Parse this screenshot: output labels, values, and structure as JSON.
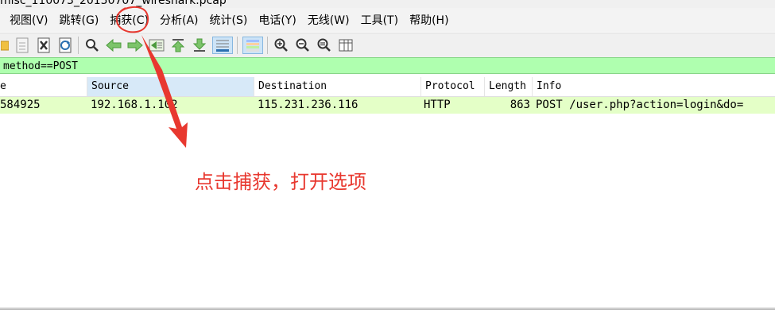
{
  "window": {
    "title": "misc_110073_20150707_wireshark.pcap"
  },
  "menu": [
    {
      "label": "视图(V)"
    },
    {
      "label": "跳转(G)"
    },
    {
      "label": "捕获(C)"
    },
    {
      "label": "分析(A)"
    },
    {
      "label": "统计(S)"
    },
    {
      "label": "电话(Y)"
    },
    {
      "label": "无线(W)"
    },
    {
      "label": "工具(T)"
    },
    {
      "label": "帮助(H)"
    }
  ],
  "toolbar": {
    "icons": [
      "folder-icon",
      "document-icon",
      "close-file-icon",
      "reload-icon",
      "find-icon",
      "back-icon",
      "forward-icon",
      "goto-icon",
      "first-packet-icon",
      "last-packet-icon",
      "autoscroll-icon",
      "colorize-icon",
      "zoom-in-icon",
      "zoom-out-icon",
      "zoom-reset-icon",
      "resize-columns-icon"
    ]
  },
  "filter": {
    "value": "method==POST"
  },
  "columns": [
    "e",
    "Source",
    "Destination",
    "Protocol",
    "Length",
    "Info"
  ],
  "packets": [
    {
      "time": "584925",
      "source": "192.168.1.102",
      "destination": "115.231.236.116",
      "protocol": "HTTP",
      "length": "863",
      "info": "POST /user.php?action=login&do="
    }
  ],
  "annotation": {
    "text": "点击捕获，打开选项",
    "color": "#e8382f"
  },
  "colors": {
    "filter_bg": "#afffaf",
    "row_bg": "#e4ffc7",
    "selected_col_bg": "#d7e9f8"
  }
}
